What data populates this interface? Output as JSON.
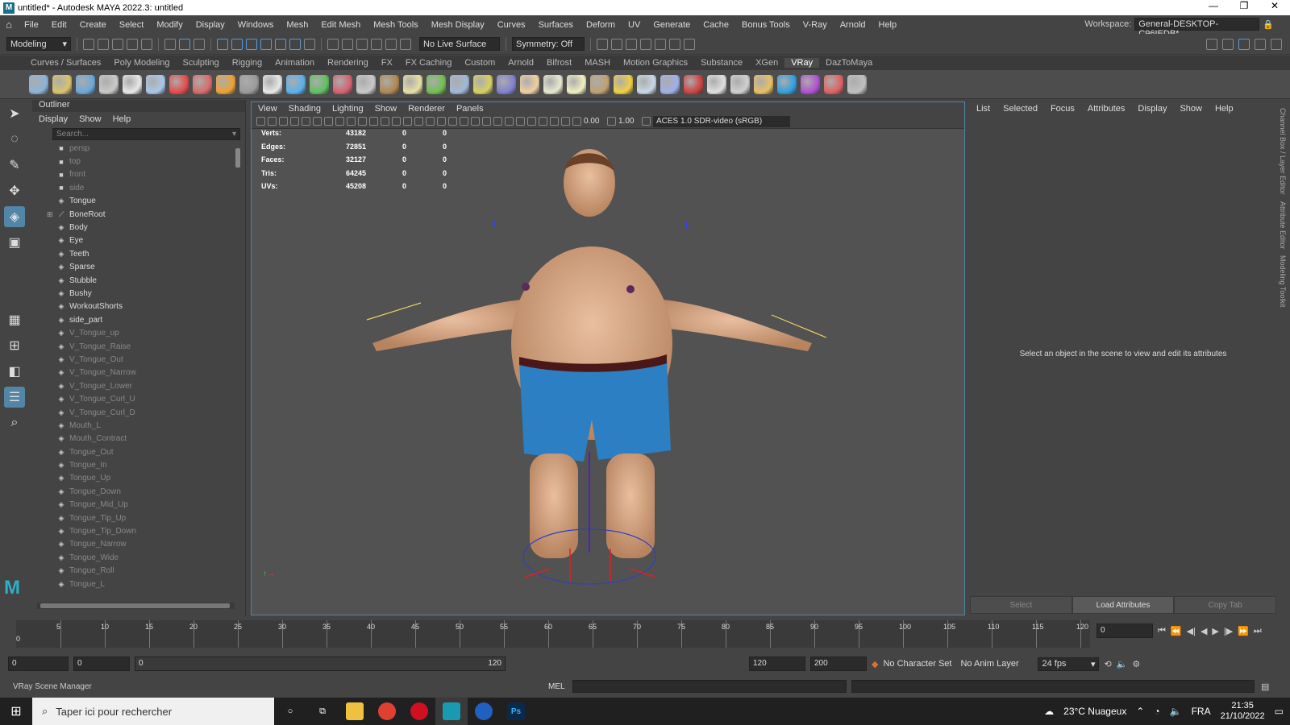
{
  "window": {
    "title": "untitled* - Autodesk MAYA 2022.3: untitled"
  },
  "menu": [
    "File",
    "Edit",
    "Create",
    "Select",
    "Modify",
    "Display",
    "Windows",
    "Mesh",
    "Edit Mesh",
    "Mesh Tools",
    "Mesh Display",
    "Curves",
    "Surfaces",
    "Deform",
    "UV",
    "Generate",
    "Cache",
    "Bonus Tools",
    "V-Ray",
    "Arnold",
    "Help"
  ],
  "workspace": {
    "label": "Workspace:",
    "value": "General-DESKTOP-C96IEDB*"
  },
  "statusline": {
    "mode": "Modeling",
    "live_surface": "No Live Surface",
    "symmetry": "Symmetry: Off"
  },
  "shelf_tabs": [
    "Curves / Surfaces",
    "Poly Modeling",
    "Sculpting",
    "Rigging",
    "Animation",
    "Rendering",
    "FX",
    "FX Caching",
    "Custom",
    "Arnold",
    "Bifrost",
    "MASH",
    "Motion Graphics",
    "Substance",
    "XGen",
    "VRay",
    "DazToMaya"
  ],
  "shelf_active": "VRay",
  "shelf_icon_colors": [
    "#8ab4d8",
    "#d8c46a",
    "#6aa8d8",
    "#c9c9c9",
    "#e8e8e8",
    "#a8c8e8",
    "#e84a4a",
    "#d86a6a",
    "#f0a030",
    "#9a9a9a",
    "#e8e8e8",
    "#5ab0f0",
    "#60c060",
    "#d86070",
    "#c8c8c8",
    "#b08850",
    "#e8e0a0",
    "#70c050",
    "#a0b8d8",
    "#d8d060",
    "#8080d0",
    "#f0d0a0",
    "#e8e8d0",
    "#f0f0c0",
    "#c0a070",
    "#f0d040",
    "#c8d8e8",
    "#a0b0e8",
    "#d04040",
    "#e0e0e0",
    "#d0d0d0",
    "#e8c060",
    "#30a0e0",
    "#b050d0",
    "#e06060",
    "#c0c0c0"
  ],
  "outliner": {
    "title": "Outliner",
    "menu": [
      "Display",
      "Show",
      "Help"
    ],
    "search_placeholder": "Search...",
    "items": [
      {
        "label": "persp",
        "icon": "camera",
        "dim": true
      },
      {
        "label": "top",
        "icon": "camera",
        "dim": true
      },
      {
        "label": "front",
        "icon": "camera",
        "dim": true
      },
      {
        "label": "side",
        "icon": "camera",
        "dim": true
      },
      {
        "label": "Tongue",
        "icon": "mesh"
      },
      {
        "label": "BoneRoot",
        "icon": "joint",
        "expandable": true
      },
      {
        "label": "Body",
        "icon": "mesh"
      },
      {
        "label": "Eye",
        "icon": "mesh"
      },
      {
        "label": "Teeth",
        "icon": "mesh"
      },
      {
        "label": "Sparse",
        "icon": "mesh"
      },
      {
        "label": "Stubble",
        "icon": "mesh"
      },
      {
        "label": "Bushy",
        "icon": "mesh"
      },
      {
        "label": "WorkoutShorts",
        "icon": "mesh"
      },
      {
        "label": "side_part",
        "icon": "mesh"
      },
      {
        "label": "V_Tongue_up",
        "icon": "mesh",
        "dim": true
      },
      {
        "label": "V_Tongue_Raise",
        "icon": "mesh",
        "dim": true
      },
      {
        "label": "V_Tongue_Out",
        "icon": "mesh",
        "dim": true
      },
      {
        "label": "V_Tongue_Narrow",
        "icon": "mesh",
        "dim": true
      },
      {
        "label": "V_Tongue_Lower",
        "icon": "mesh",
        "dim": true
      },
      {
        "label": "V_Tongue_Curl_U",
        "icon": "mesh",
        "dim": true
      },
      {
        "label": "V_Tongue_Curl_D",
        "icon": "mesh",
        "dim": true
      },
      {
        "label": "Mouth_L",
        "icon": "mesh",
        "dim": true
      },
      {
        "label": "Mouth_Contract",
        "icon": "mesh",
        "dim": true
      },
      {
        "label": "Tongue_Out",
        "icon": "mesh",
        "dim": true
      },
      {
        "label": "Tongue_In",
        "icon": "mesh",
        "dim": true
      },
      {
        "label": "Tongue_Up",
        "icon": "mesh",
        "dim": true
      },
      {
        "label": "Tongue_Down",
        "icon": "mesh",
        "dim": true
      },
      {
        "label": "Tongue_Mid_Up",
        "icon": "mesh",
        "dim": true
      },
      {
        "label": "Tongue_Tip_Up",
        "icon": "mesh",
        "dim": true
      },
      {
        "label": "Tongue_Tip_Down",
        "icon": "mesh",
        "dim": true
      },
      {
        "label": "Tongue_Narrow",
        "icon": "mesh",
        "dim": true
      },
      {
        "label": "Tongue_Wide",
        "icon": "mesh",
        "dim": true
      },
      {
        "label": "Tongue_Roll",
        "icon": "mesh",
        "dim": true
      },
      {
        "label": "Tongue_L",
        "icon": "mesh",
        "dim": true
      }
    ]
  },
  "viewport": {
    "menu": [
      "View",
      "Shading",
      "Lighting",
      "Show",
      "Renderer",
      "Panels"
    ],
    "exposure": "0.00",
    "gamma": "1.00",
    "color_space": "ACES 1.0 SDR-video (sRGB)",
    "hud": [
      {
        "k": "Verts:",
        "v": "43182",
        "a": "0",
        "b": "0"
      },
      {
        "k": "Edges:",
        "v": "72851",
        "a": "0",
        "b": "0"
      },
      {
        "k": "Faces:",
        "v": "32127",
        "a": "0",
        "b": "0"
      },
      {
        "k": "Tris:",
        "v": "64245",
        "a": "0",
        "b": "0"
      },
      {
        "k": "UVs:",
        "v": "45208",
        "a": "0",
        "b": "0"
      }
    ]
  },
  "attribute_editor": {
    "menu": [
      "List",
      "Selected",
      "Focus",
      "Attributes",
      "Display",
      "Show",
      "Help"
    ],
    "message": "Select an object in the scene to view and edit its attributes",
    "buttons": [
      "Select",
      "Load Attributes",
      "Copy Tab"
    ]
  },
  "side_tabs": [
    "Channel Box / Layer Editor",
    "Attribute Editor",
    "Modeling Toolkit"
  ],
  "timeline": {
    "ticks": [
      "5",
      "10",
      "15",
      "20",
      "25",
      "30",
      "35",
      "40",
      "45",
      "50",
      "55",
      "60",
      "65",
      "70",
      "75",
      "80",
      "85",
      "90",
      "95",
      "100",
      "105",
      "110",
      "115",
      "120"
    ],
    "current": "0",
    "frame_field": "0"
  },
  "range": {
    "start": "0",
    "anim_start": "0",
    "range_start": "0",
    "range_end": "120",
    "end": "120",
    "anim_end": "200",
    "character_set": "No Character Set",
    "anim_layer": "No Anim Layer",
    "fps": "24 fps"
  },
  "cmdline": {
    "help": "VRay Scene Manager",
    "lang": "MEL"
  },
  "taskbar": {
    "search": "Taper ici pour rechercher",
    "weather": "23°C  Nuageux",
    "lang": "FRA",
    "time": "21:35",
    "date": "21/10/2022"
  }
}
